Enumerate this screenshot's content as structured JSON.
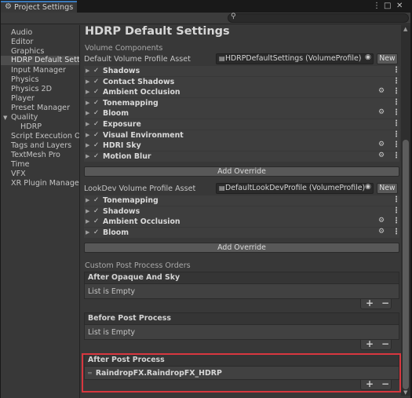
{
  "window": {
    "tab_title": "Project Settings",
    "tab_icon": "gear-icon",
    "controls": [
      "⋮",
      "□",
      "✕"
    ]
  },
  "search": {
    "placeholder": "",
    "icon": "search-icon"
  },
  "sidebar": {
    "items": [
      {
        "label": "Audio"
      },
      {
        "label": "Editor"
      },
      {
        "label": "Graphics"
      },
      {
        "label": "HDRP Default Settings",
        "selected": true
      },
      {
        "label": "Input Manager"
      },
      {
        "label": "Physics"
      },
      {
        "label": "Physics 2D"
      },
      {
        "label": "Player"
      },
      {
        "label": "Preset Manager"
      },
      {
        "label": "Quality",
        "expandable": true
      },
      {
        "label": "HDRP",
        "child": true
      },
      {
        "label": "Script Execution Order"
      },
      {
        "label": "Tags and Layers"
      },
      {
        "label": "TextMesh Pro"
      },
      {
        "label": "Time"
      },
      {
        "label": "VFX"
      },
      {
        "label": "XR Plugin Management"
      }
    ]
  },
  "main": {
    "title": "HDRP Default Settings",
    "volume_components_label": "Volume Components",
    "default_volume": {
      "label": "Default Volume Profile Asset",
      "value": "HDRPDefaultSettings (VolumeProfile)",
      "new_label": "New"
    },
    "components": [
      {
        "name": "Shadows",
        "checked": true,
        "has_fx": false
      },
      {
        "name": "Contact Shadows",
        "checked": true,
        "has_fx": false
      },
      {
        "name": "Ambient Occlusion",
        "checked": true,
        "has_fx": true
      },
      {
        "name": "Tonemapping",
        "checked": true,
        "has_fx": false
      },
      {
        "name": "Bloom",
        "checked": true,
        "has_fx": true
      },
      {
        "name": "Exposure",
        "checked": true,
        "has_fx": false
      },
      {
        "name": "Visual Environment",
        "checked": true,
        "has_fx": false
      },
      {
        "name": "HDRI Sky",
        "checked": true,
        "has_fx": true
      },
      {
        "name": "Motion Blur",
        "checked": true,
        "has_fx": true
      }
    ],
    "add_override_label": "Add Override",
    "lookdev_volume": {
      "label": "LookDev Volume Profile Asset",
      "value": "DefaultLookDevProfile (VolumeProfile)",
      "new_label": "New"
    },
    "lookdev_components": [
      {
        "name": "Tonemapping",
        "checked": true,
        "has_fx": false
      },
      {
        "name": "Shadows",
        "checked": true,
        "has_fx": false
      },
      {
        "name": "Ambient Occlusion",
        "checked": true,
        "has_fx": true
      },
      {
        "name": "Bloom",
        "checked": true,
        "has_fx": true
      }
    ],
    "add_override_label_2": "Add Override",
    "custom_pp_label": "Custom Post Process Orders",
    "lists": [
      {
        "header": "After Opaque And Sky",
        "items": [],
        "empty_text": "List is Empty"
      },
      {
        "header": "Before Post Process",
        "items": [],
        "empty_text": "List is Empty"
      },
      {
        "header": "After Post Process",
        "items": [
          "RaindropFX.RaindropFX_HDRP"
        ],
        "empty_text": ""
      }
    ],
    "plus": "+",
    "minus": "−"
  },
  "colors": {
    "accent_tab": "#3a79bb",
    "highlight_box": "#d8373f",
    "panel_bg": "#383838"
  }
}
